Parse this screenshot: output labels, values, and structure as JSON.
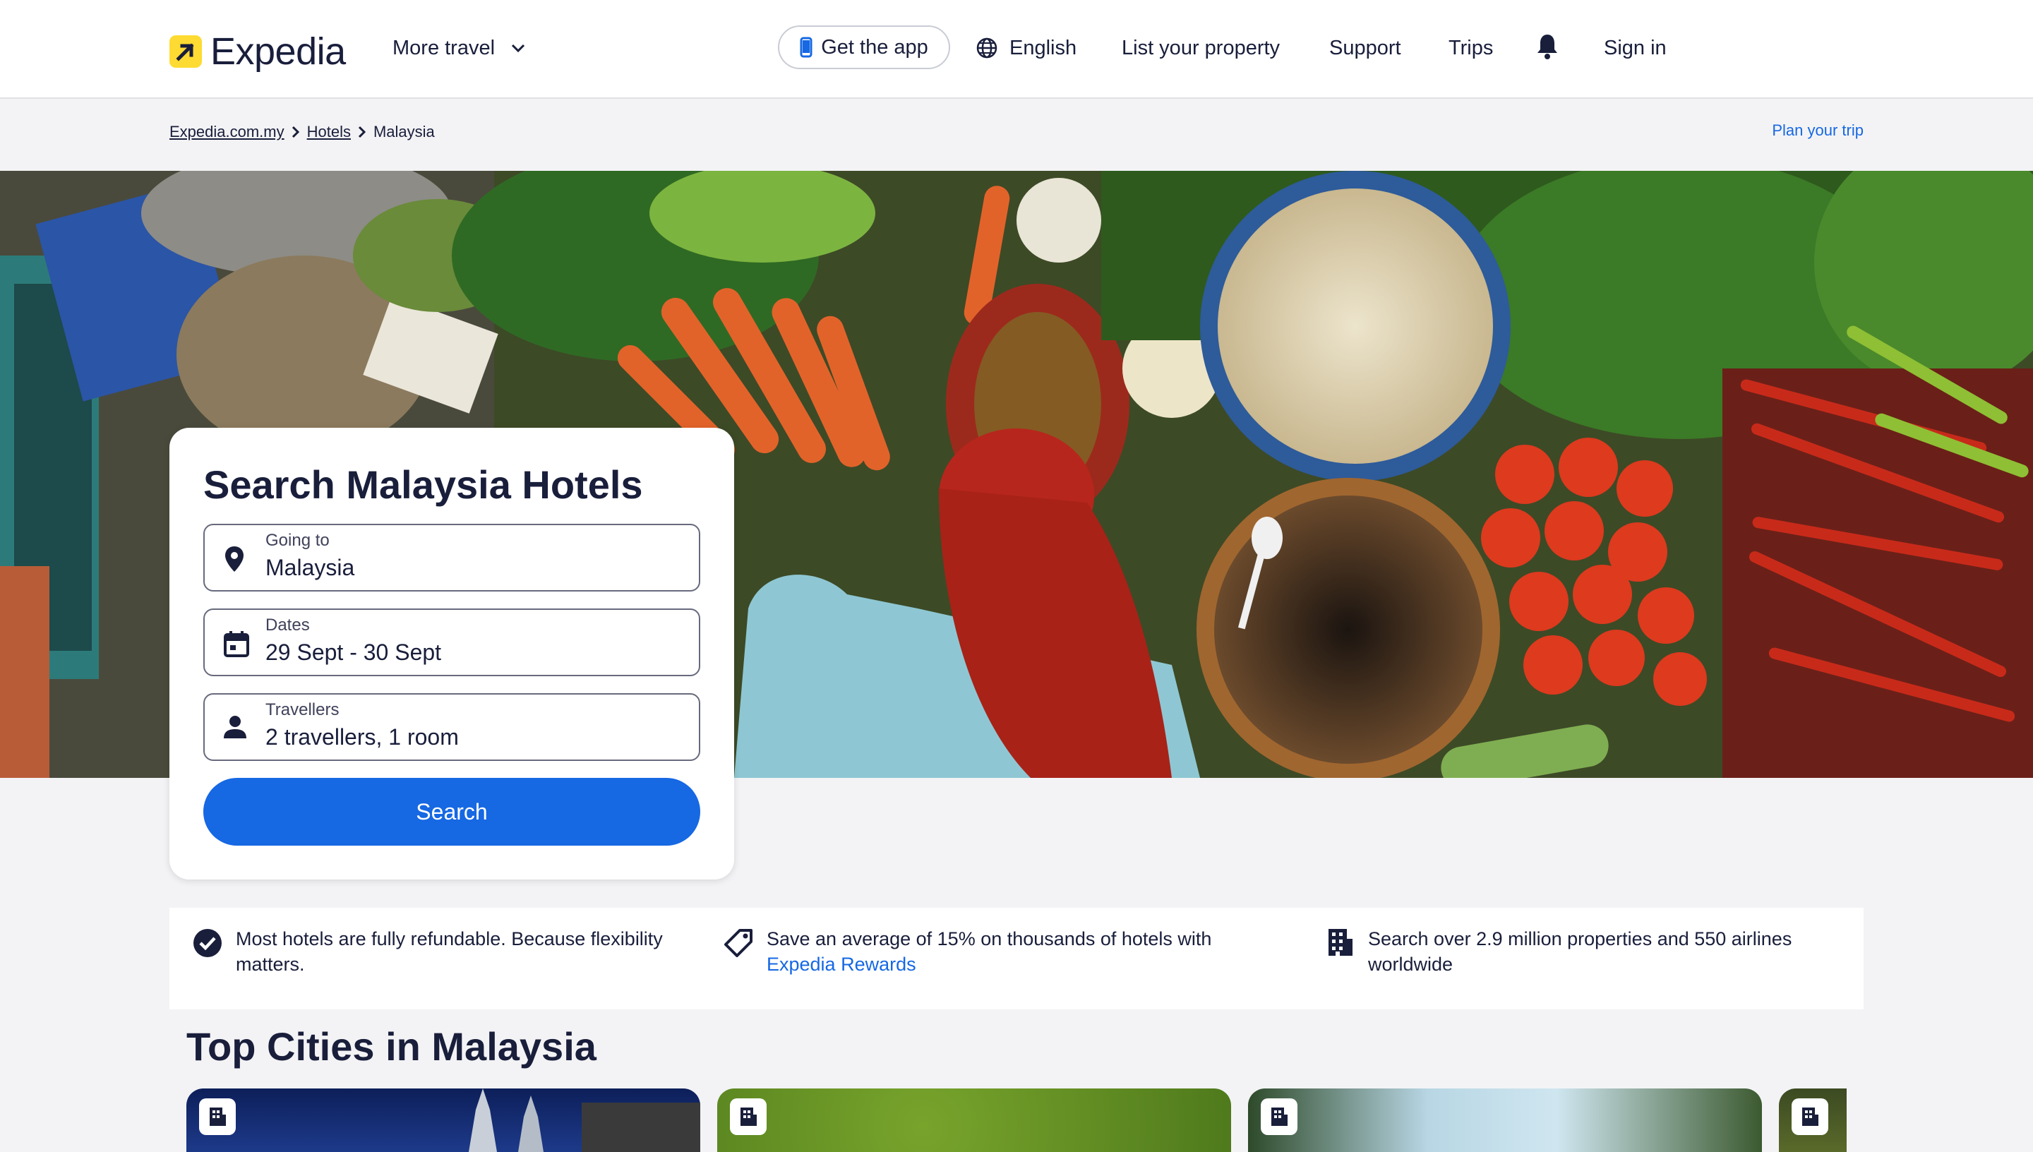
{
  "header": {
    "brand": "Expedia",
    "more_travel": "More travel",
    "get_app": "Get the app",
    "language": "English",
    "list_property": "List your property",
    "support": "Support",
    "trips": "Trips",
    "sign_in": "Sign in"
  },
  "breadcrumb": {
    "items": [
      "Expedia.com.my",
      "Hotels",
      "Malaysia"
    ],
    "plan_trip": "Plan your trip"
  },
  "search": {
    "title": "Search Malaysia Hotels",
    "going_to_label": "Going to",
    "going_to_value": "Malaysia",
    "dates_label": "Dates",
    "dates_value": "29 Sept - 30 Sept",
    "travellers_label": "Travellers",
    "travellers_value": "2 travellers, 1 room",
    "button": "Search"
  },
  "benefits": [
    {
      "text": "Most hotels are fully refundable. Because flexibility matters.",
      "icon": "check-circle-icon"
    },
    {
      "text": "Save an average of 15% on thousands of hotels with",
      "link": "Expedia Rewards",
      "icon": "tag-icon"
    },
    {
      "text": "Search over 2.9 million properties and 550 airlines worldwide",
      "icon": "building-icon"
    }
  ],
  "top_cities": {
    "title": "Top Cities in Malaysia"
  },
  "colors": {
    "brand_blue": "#1668e3",
    "brand_yellow": "#fddb32",
    "text_dark": "#191e3b"
  }
}
